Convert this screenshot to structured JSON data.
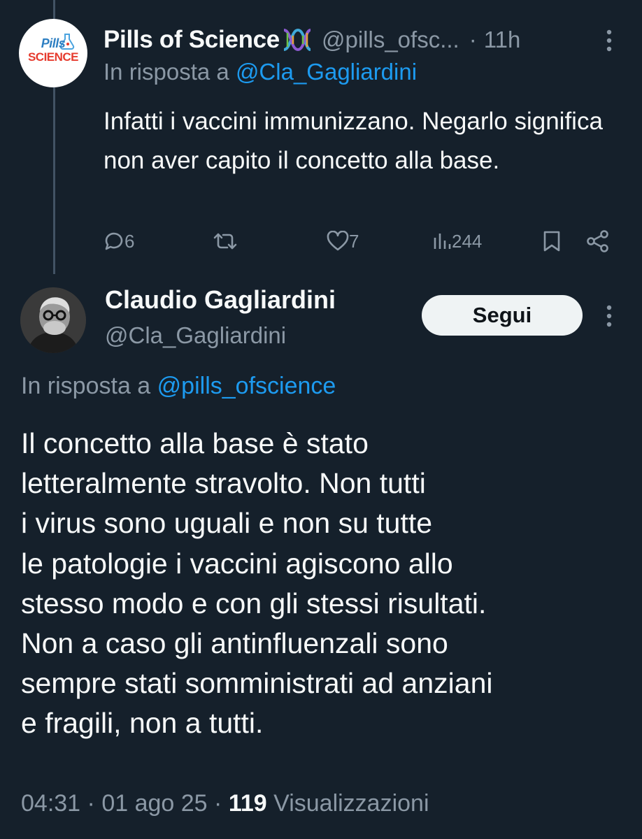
{
  "reply_tweet": {
    "author_name": "Pills of Science",
    "author_emoji": "dna-icon",
    "handle": "@pills_ofsc...",
    "separator": "·",
    "time_ago": "11h",
    "reply_prefix": "In risposta a",
    "reply_to": "@Cla_Gagliardini",
    "text": "Infatti i vaccini immunizzano. Negarlo significa non aver capito il concetto alla base.",
    "avatar_logo": {
      "line1": "Pills",
      "line2": "SCIENCE",
      "small": "of"
    },
    "stats": {
      "replies": "6",
      "likes": "7",
      "views": "244"
    }
  },
  "main_tweet": {
    "author_name": "Claudio Gagliardini",
    "handle": "@Cla_Gagliardini",
    "follow_label": "Segui",
    "reply_prefix": "In risposta a",
    "reply_to": "@pills_ofscience",
    "text_lines": [
      "Il concetto alla base è stato",
      "letteralmente stravolto. Non tutti",
      "i virus sono uguali e non su tutte",
      "le patologie i vaccini agiscono allo",
      "stesso modo e con gli stessi risultati.",
      "Non a caso gli antinfluenzali sono",
      "sempre stati somministrati ad anziani",
      "e fragili, non a tutti."
    ],
    "time": "04:31",
    "date": "01 ago 25",
    "separator": "·",
    "views_count": "119",
    "views_label": "Visualizzazioni"
  },
  "colors": {
    "background": "#15202b",
    "text_primary": "#f7f9f9",
    "text_secondary": "#8b98a5",
    "link": "#1d9bf0",
    "thread_line": "#425364"
  }
}
